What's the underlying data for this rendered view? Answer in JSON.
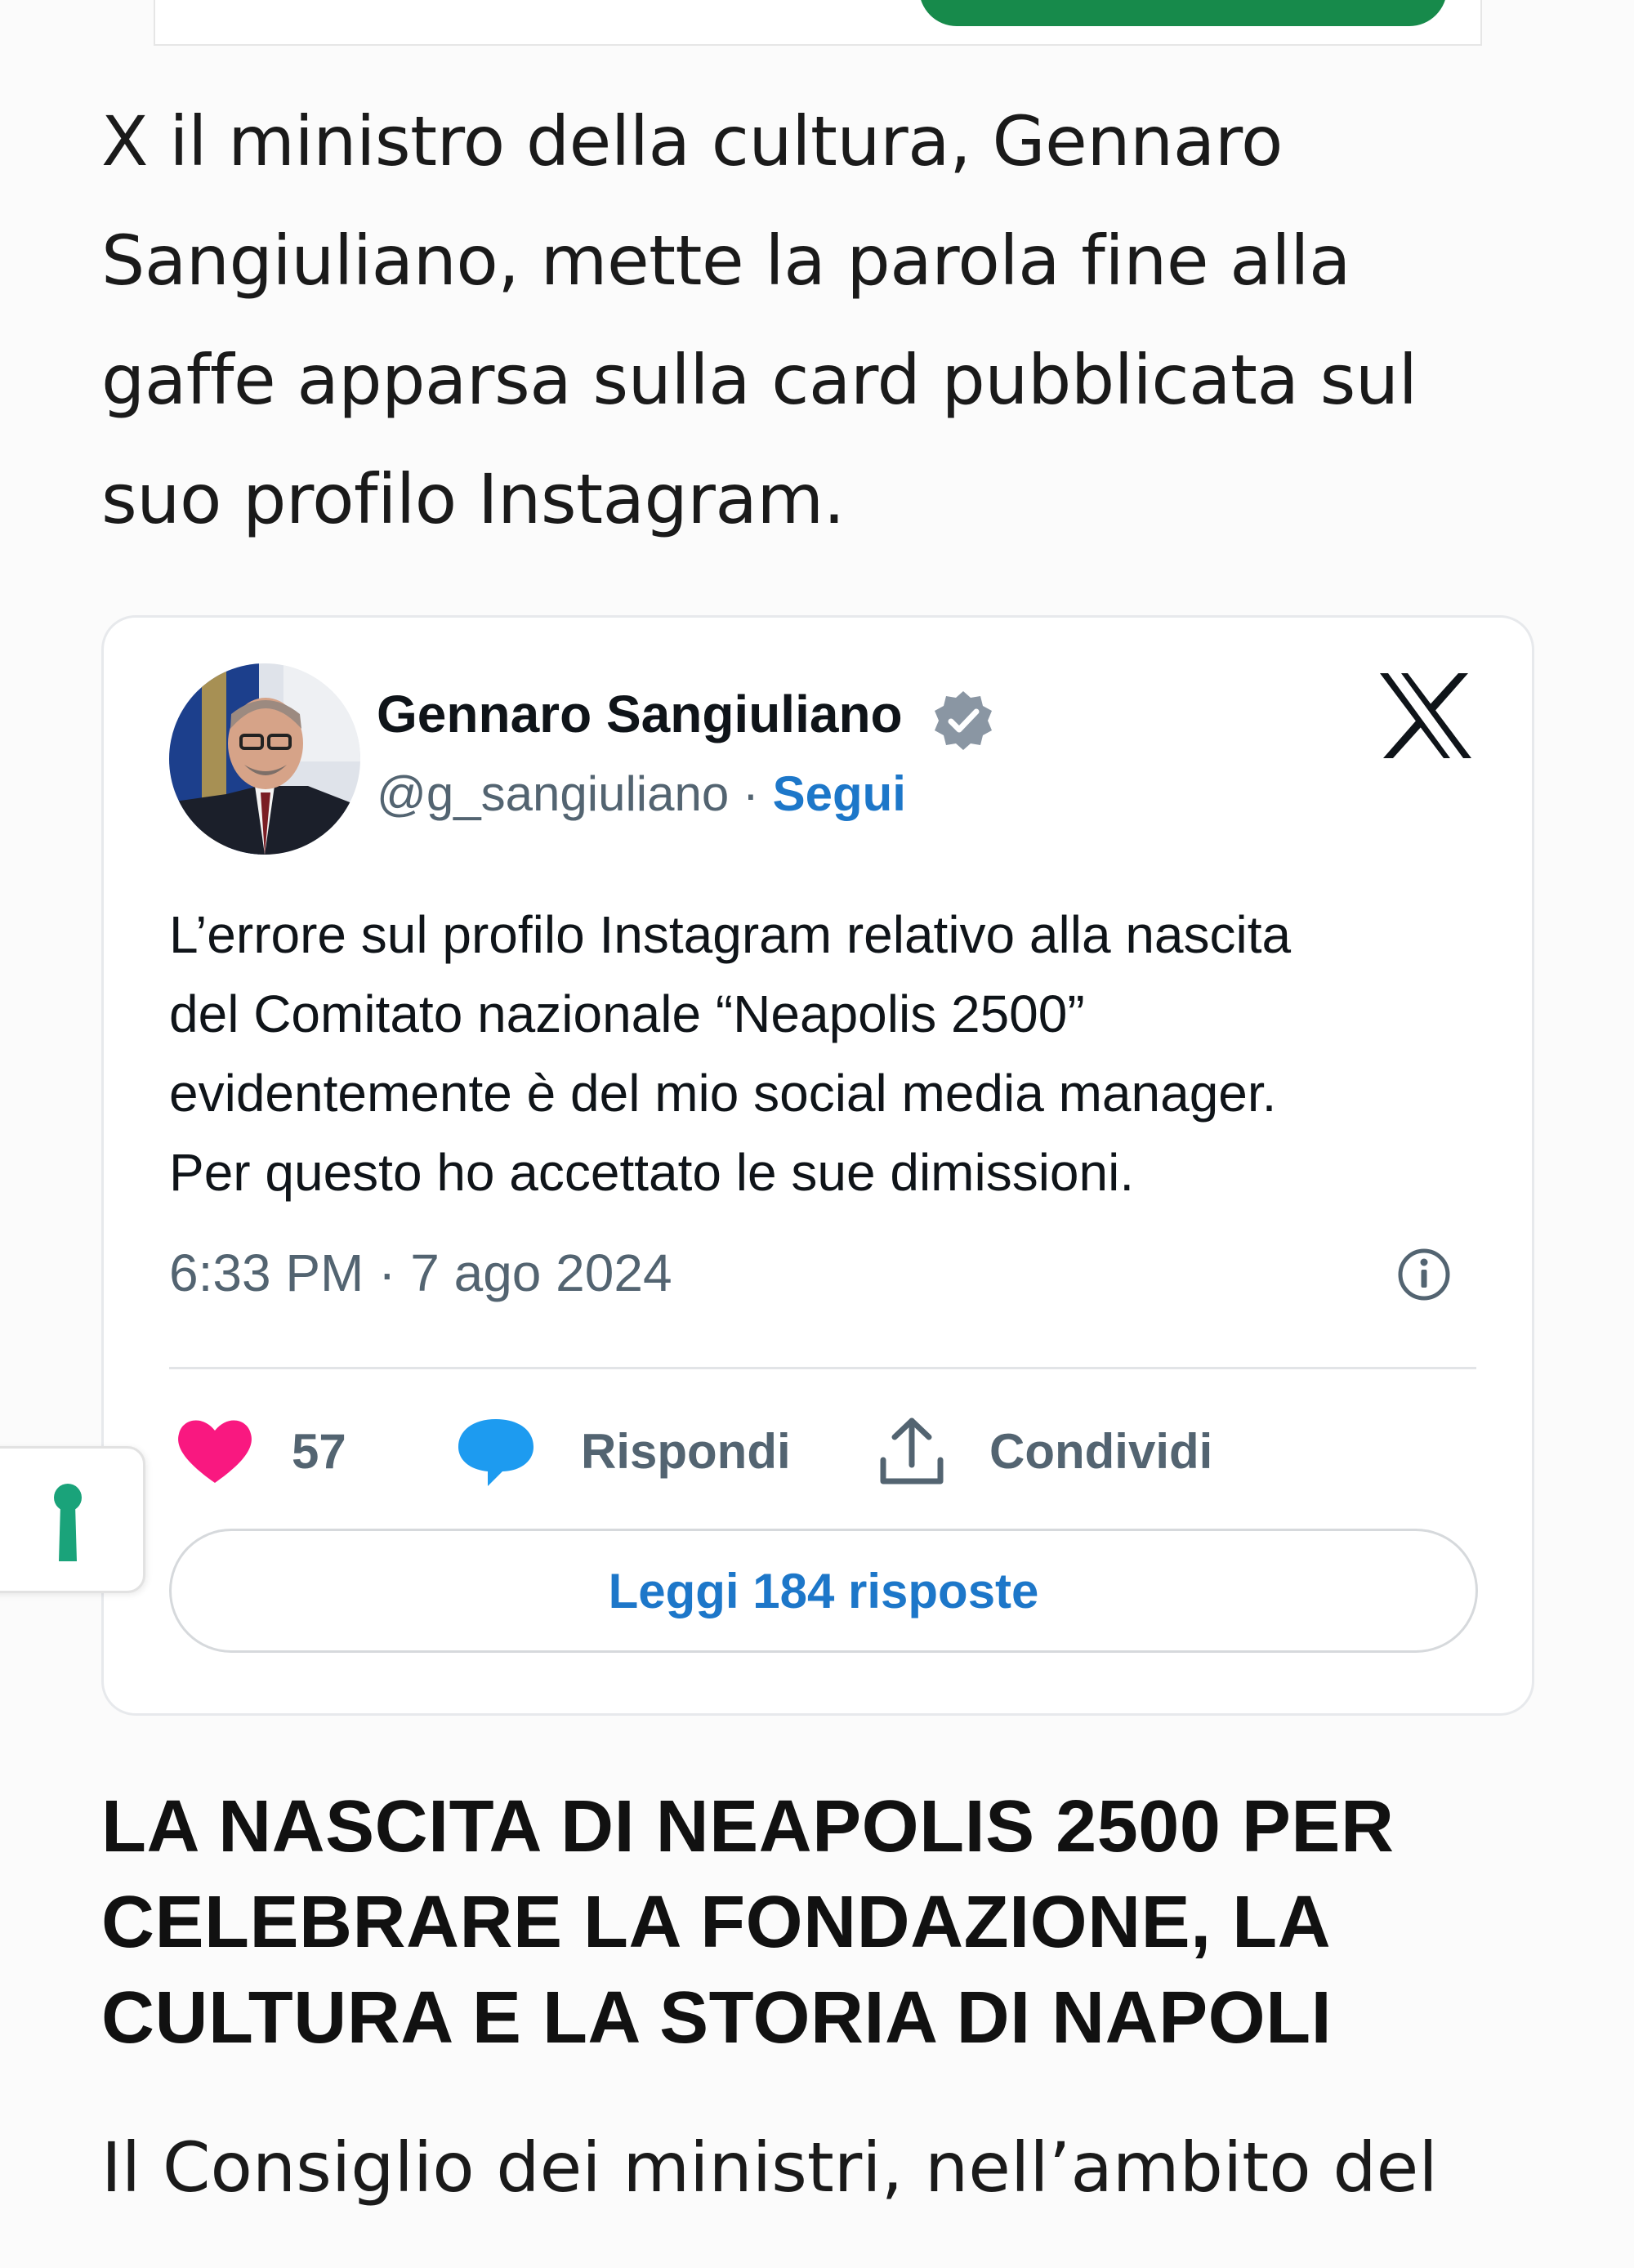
{
  "article": {
    "intro_lines": [
      "X il ministro della cultura, Gennaro",
      "Sangiuliano, mette la parola fine alla",
      "gaffe apparsa sulla card pubblicata sul",
      "suo profilo Instagram."
    ],
    "section_heading_lines": [
      "LA NASCITA DI NEAPOLIS 2500 PER",
      "CELEBRARE LA FONDAZIONE, LA",
      "CULTURA E LA STORIA DI NAPOLI"
    ],
    "body_lines": [
      "Il Consiglio dei ministri, nell’ambito del"
    ]
  },
  "tweet": {
    "author_name": "Gennaro Sangiuliano",
    "handle": "@g_sangiuliano",
    "separator": "·",
    "follow_label": "Segui",
    "text_lines": [
      "L’errore sul profilo Instagram relativo alla nascita",
      "del Comitato nazionale “Neapolis 2500”",
      "evidentemente è del mio social media manager.",
      "Per questo ho accettato le sue dimissioni."
    ],
    "timestamp": "6:33 PM · 7 ago 2024",
    "likes_count": "57",
    "reply_label": "Rispondi",
    "share_label": "Condividi",
    "read_replies_label": "Leggi 184 risposte",
    "icons": {
      "verified": "verified-badge-icon",
      "platform": "x-logo-icon",
      "info": "info-icon",
      "like": "heart-icon",
      "reply": "speech-bubble-icon",
      "share": "share-upload-icon"
    }
  },
  "side_tab": {
    "icon": "keyhole-icon"
  },
  "colors": {
    "accent_blue": "#1d77c9",
    "heart_pink": "#f91880",
    "reply_blue": "#1d9bf0",
    "green_button": "#178a4b",
    "side_tab_icon": "#1aa37a",
    "muted_text": "#536471"
  }
}
